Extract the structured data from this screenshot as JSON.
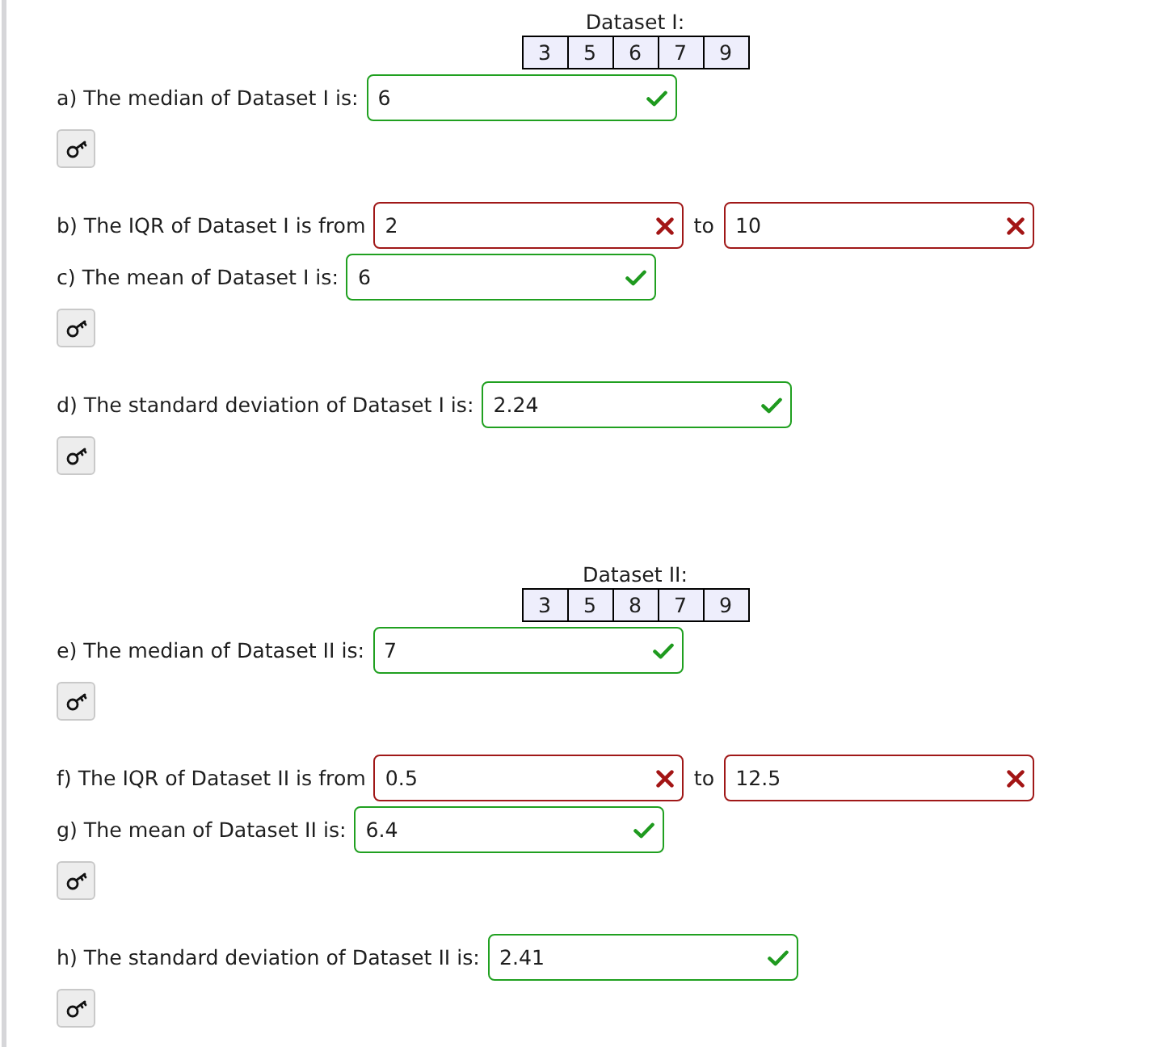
{
  "sections": [
    {
      "dataset": {
        "title": "Dataset I:",
        "values": [
          "3",
          "5",
          "6",
          "7",
          "9"
        ]
      },
      "parts": [
        {
          "label": "a) The median of Dataset I is:",
          "answers": [
            {
              "value": "6",
              "correct": true
            }
          ],
          "key_button": true
        },
        {
          "label": "b) The IQR of Dataset I is from",
          "joiner": "to",
          "answers": [
            {
              "value": "2",
              "correct": false
            },
            {
              "value": "10",
              "correct": false
            }
          ],
          "key_button": false
        },
        {
          "label": "c) The mean of Dataset I is:",
          "answers": [
            {
              "value": "6",
              "correct": true
            }
          ],
          "key_button": true
        },
        {
          "label": "d) The standard deviation of Dataset I is:",
          "answers": [
            {
              "value": "2.24",
              "correct": true
            }
          ],
          "key_button": true
        }
      ]
    },
    {
      "dataset": {
        "title": "Dataset II:",
        "values": [
          "3",
          "5",
          "8",
          "7",
          "9"
        ]
      },
      "parts": [
        {
          "label": "e) The median of Dataset II is:",
          "answers": [
            {
              "value": "7",
              "correct": true
            }
          ],
          "key_button": true
        },
        {
          "label": "f) The IQR of Dataset II is from",
          "joiner": "to",
          "answers": [
            {
              "value": "0.5",
              "correct": false
            },
            {
              "value": "12.5",
              "correct": false
            }
          ],
          "key_button": false
        },
        {
          "label": "g) The mean of Dataset II is:",
          "answers": [
            {
              "value": "6.4",
              "correct": true
            }
          ],
          "key_button": true
        },
        {
          "label": "h) The standard deviation of Dataset II is:",
          "answers": [
            {
              "value": "2.41",
              "correct": true
            }
          ],
          "key_button": true
        }
      ]
    }
  ]
}
